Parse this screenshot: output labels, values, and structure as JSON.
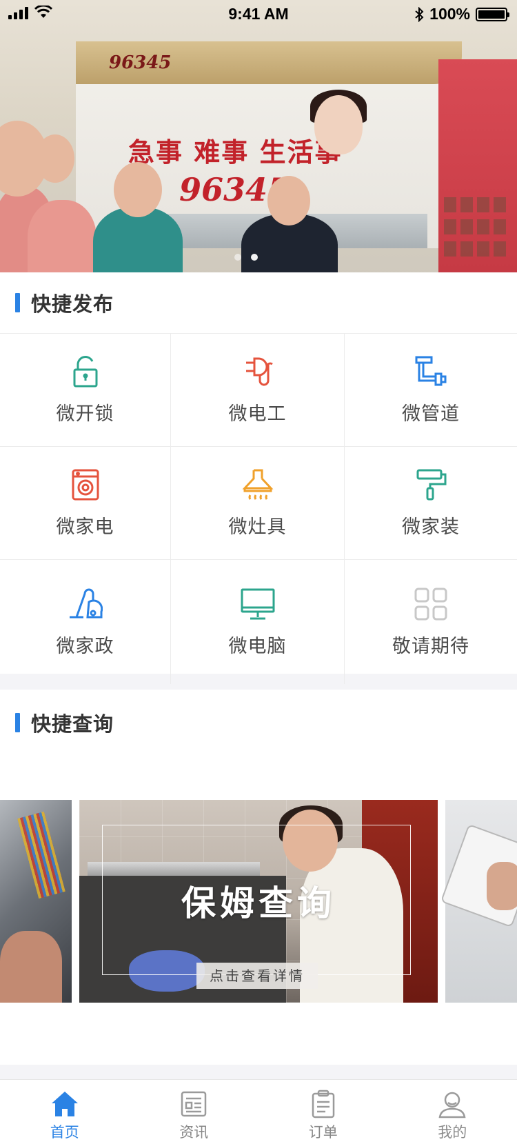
{
  "status_bar": {
    "time": "9:41 AM",
    "battery": "100%"
  },
  "banner": {
    "logo_text": "96345",
    "slogan": "急事 难事 生活事",
    "hotline": "96345",
    "active_slide": 1,
    "slide_count": 2
  },
  "quick_publish": {
    "title": "快捷发布",
    "items": [
      {
        "label": "微开锁",
        "icon": "unlock-icon",
        "color": "#2ca58d"
      },
      {
        "label": "微电工",
        "icon": "plug-icon",
        "color": "#e5533d"
      },
      {
        "label": "微管道",
        "icon": "pipe-icon",
        "color": "#2a82e4"
      },
      {
        "label": "微家电",
        "icon": "washing-machine-icon",
        "color": "#e5533d"
      },
      {
        "label": "微灶具",
        "icon": "range-hood-icon",
        "color": "#f0a12b"
      },
      {
        "label": "微家装",
        "icon": "paint-roller-icon",
        "color": "#2ca58d"
      },
      {
        "label": "微家政",
        "icon": "vacuum-icon",
        "color": "#2a82e4"
      },
      {
        "label": "微电脑",
        "icon": "monitor-icon",
        "color": "#2ca58d"
      },
      {
        "label": "敬请期待",
        "icon": "grid-icon",
        "color": "#c8c8c8"
      }
    ]
  },
  "quick_query": {
    "title": "快捷查询",
    "card_title": "保姆查询",
    "card_button": "点击查看详情"
  },
  "tabbar": {
    "tabs": [
      {
        "label": "首页",
        "icon": "home-icon",
        "active": true
      },
      {
        "label": "资讯",
        "icon": "news-icon",
        "active": false
      },
      {
        "label": "订单",
        "icon": "order-icon",
        "active": false
      },
      {
        "label": "我的",
        "icon": "user-icon",
        "active": false
      }
    ]
  },
  "colors": {
    "accent": "#2a82e4",
    "background": "#f4f4f7"
  }
}
